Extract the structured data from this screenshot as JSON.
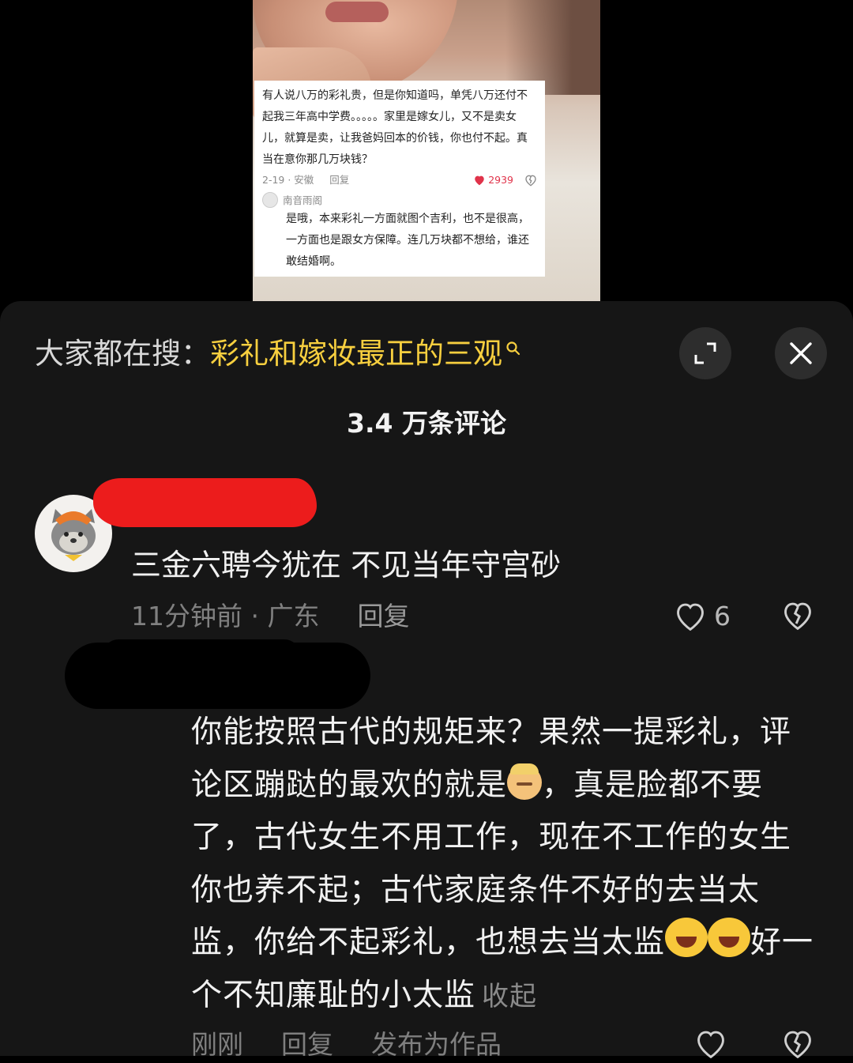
{
  "video": {
    "card": {
      "comment_text": "有人说八万的彩礼贵，但是你知道吗，单凭八万还付不起我三年高中学费。。。。。家里是嫁女儿，又不是卖女儿，就算是卖，让我爸妈回本的价钱，你也付不起。真当在意你那几万块钱？",
      "comment_meta": "2-19 · 安徽",
      "comment_reply": "回复",
      "comment_likes": "2939",
      "reply_name": "南音雨阁",
      "reply_text": "是哦，本来彩礼一方面就图个吉利，也不是很高，一方面也是跟女方保障。连几万块都不想给，谁还敢结婚啊。"
    }
  },
  "panel": {
    "search_prefix": "大家都在搜：",
    "search_topic": "彩礼和嫁妆最正的三观",
    "comment_count": "3.4 万条评论"
  },
  "comments": [
    {
      "text": "三金六聘今犹在 不见当年守宫砂",
      "meta": "11分钟前 · 广东",
      "reply_label": "回复",
      "likes": "6"
    },
    {
      "text_part1": "你能按照古代的规矩来？果然一提彩礼，评论区蹦跶的最欢的就是",
      "text_part2": "，真是脸都不要了，古代女生不用工作，现在不工作的女生你也养不起；古代家庭条件不好的去当太监，你给不起彩礼，也想去当太监",
      "text_part3": "好一个不知廉耻的小太监",
      "collapse_label": "收起",
      "time": "刚刚",
      "reply_label": "回复",
      "publish_label": "发布为作品"
    }
  ],
  "colors": {
    "topic": "#f7cf3f",
    "panel_bg": "#161616",
    "redact_red": "#ec1c1c"
  },
  "icons": [
    "search-icon",
    "expand-icon",
    "close-icon",
    "heart-icon",
    "broken-heart-icon"
  ]
}
